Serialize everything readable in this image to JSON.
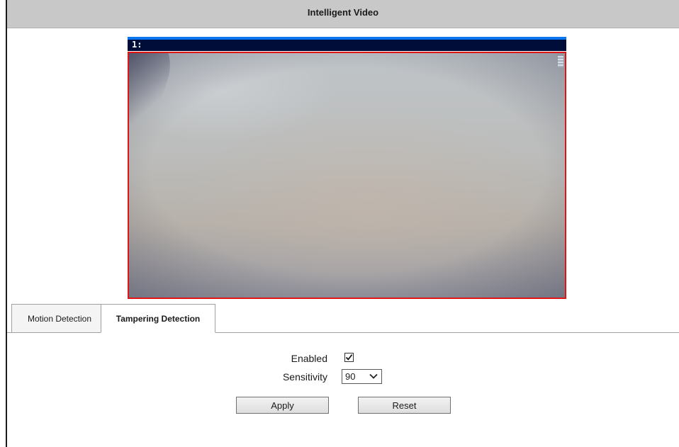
{
  "title": "Intelligent Video",
  "video": {
    "channel_label": "1:"
  },
  "tabs": [
    {
      "label": "Motion Detection",
      "active": false
    },
    {
      "label": "Tampering Detection",
      "active": true
    }
  ],
  "form": {
    "enabled_label": "Enabled",
    "enabled_checked": true,
    "sensitivity_label": "Sensitivity",
    "sensitivity_value": "90"
  },
  "buttons": {
    "apply_label": "Apply",
    "reset_label": "Reset"
  },
  "colors": {
    "title_bar": "#c8c8c8",
    "video_border": "#e01414",
    "video_header_accent": "#0b74f0",
    "video_header_bg": "#000d38"
  },
  "icons": {
    "checkbox": "checkmark-icon",
    "select": "chevron-down-icon"
  }
}
